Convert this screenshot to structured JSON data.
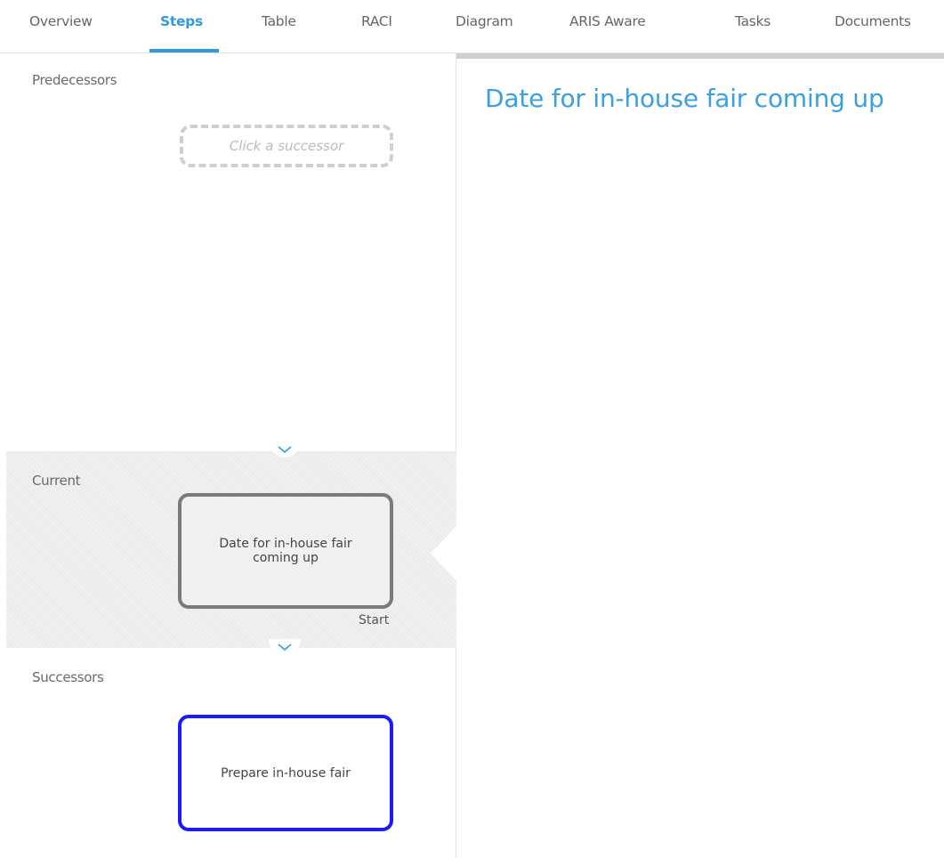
{
  "tabs": [
    {
      "label": "Overview",
      "active": false
    },
    {
      "label": "Steps",
      "active": true
    },
    {
      "label": "Table",
      "active": false
    },
    {
      "label": "RACI",
      "active": false
    },
    {
      "label": "Diagram",
      "active": false
    },
    {
      "label": "ARIS Aware",
      "active": false
    },
    {
      "label": "Tasks",
      "active": false
    },
    {
      "label": "Documents",
      "active": false
    }
  ],
  "colors": {
    "accent": "#2f9ae0",
    "successor_border": "#1a1aff",
    "current_border": "#7a7a7a"
  },
  "predecessors": {
    "label": "Predecessors",
    "placeholder": "Click a successor"
  },
  "current": {
    "label": "Current",
    "step_name": "Date for in-house fair coming up",
    "tag": "Start"
  },
  "successors": {
    "label": "Successors",
    "items": [
      {
        "step_name": "Prepare in-house fair"
      }
    ]
  },
  "detail": {
    "title": "Date for in-house fair coming up"
  },
  "icons": {
    "expand_chevron": "chevron-down-icon"
  }
}
